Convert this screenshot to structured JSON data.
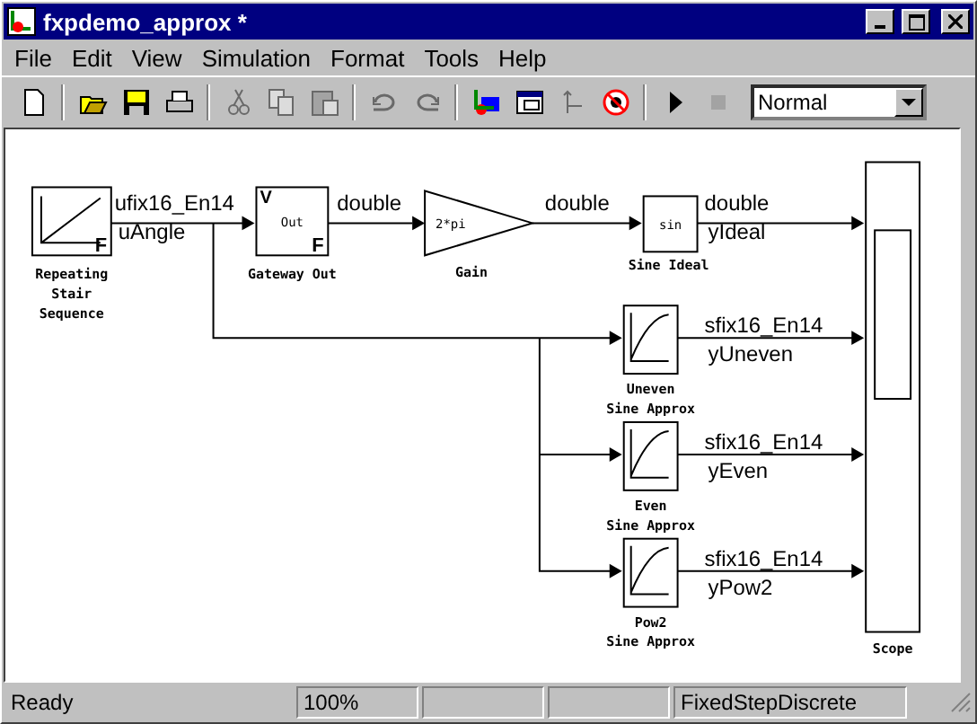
{
  "window": {
    "title": "fxpdemo_approx *"
  },
  "menu": [
    "File",
    "Edit",
    "View",
    "Simulation",
    "Format",
    "Tools",
    "Help"
  ],
  "toolbar": [
    {
      "kind": "new",
      "disabled": false
    },
    {
      "kind": "sep"
    },
    {
      "kind": "open",
      "disabled": false
    },
    {
      "kind": "save",
      "disabled": false
    },
    {
      "kind": "print",
      "disabled": false
    },
    {
      "kind": "sep"
    },
    {
      "kind": "cut",
      "disabled": true
    },
    {
      "kind": "copy",
      "disabled": true
    },
    {
      "kind": "paste",
      "disabled": true
    },
    {
      "kind": "sep"
    },
    {
      "kind": "undo",
      "disabled": true
    },
    {
      "kind": "redo",
      "disabled": true
    },
    {
      "kind": "sep"
    },
    {
      "kind": "library",
      "disabled": false
    },
    {
      "kind": "explorer",
      "disabled": false
    },
    {
      "kind": "build",
      "disabled": true
    },
    {
      "kind": "debug",
      "disabled": false
    },
    {
      "kind": "sep"
    },
    {
      "kind": "start",
      "disabled": false
    },
    {
      "kind": "stop",
      "disabled": true
    }
  ],
  "mode": {
    "value": "Normal"
  },
  "diagram": {
    "blocks": [
      {
        "kind": "stair",
        "texts": [
          "F"
        ],
        "label": [
          "Repeating",
          "Stair",
          "Sequence"
        ]
      },
      {
        "kind": "gateway",
        "texts": [
          "V",
          "Out",
          "F"
        ],
        "label": [
          "Gateway Out"
        ]
      },
      {
        "kind": "gain",
        "texts": [
          "2*pi"
        ],
        "label": [
          "Gain"
        ]
      },
      {
        "kind": "fcn",
        "texts": [
          "sin"
        ],
        "label": [
          "Sine Ideal"
        ]
      },
      {
        "kind": "lookup",
        "label": [
          "Uneven",
          "Sine Approx"
        ]
      },
      {
        "kind": "lookup",
        "label": [
          "Even",
          "Sine Approx"
        ]
      },
      {
        "kind": "lookup",
        "label": [
          "Pow2",
          "Sine Approx"
        ]
      },
      {
        "kind": "scope",
        "label": [
          "Scope"
        ]
      }
    ],
    "signals": [
      {
        "labels": [
          "ufix16_En14",
          "uAngle"
        ]
      },
      {
        "labels": [
          "double"
        ]
      },
      {
        "labels": [
          "double"
        ]
      },
      {
        "labels": [
          "double",
          "yIdeal"
        ]
      },
      {
        "labels": [
          "sfix16_En14",
          "yUneven"
        ]
      },
      {
        "labels": [
          "sfix16_En14",
          "yEven"
        ]
      },
      {
        "labels": [
          "sfix16_En14",
          "yPow2"
        ]
      }
    ]
  },
  "status_bar": {
    "message": "Ready",
    "zoom": "100%",
    "solver": "FixedStepDiscrete"
  }
}
